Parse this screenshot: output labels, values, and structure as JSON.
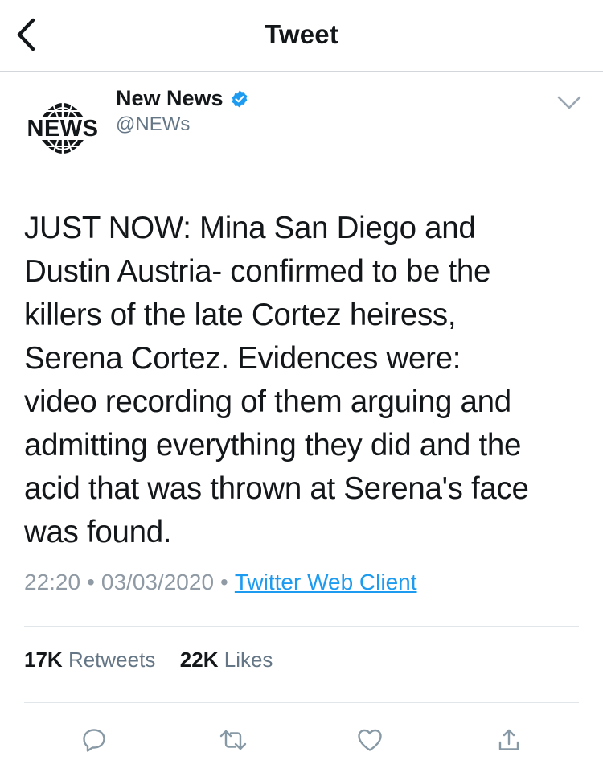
{
  "header": {
    "title": "Tweet",
    "back_icon": "chevron-left-icon"
  },
  "author": {
    "avatar_text": "NEWS",
    "name": "New News",
    "handle": "@NEWs",
    "verified": true,
    "verified_color": "#1d9bf0"
  },
  "tweet": {
    "text": "JUST NOW: Mina San Diego and\nDustin Austria- confirmed to be the\nkillers of the late Cortez heiress,\nSerena Cortez. Evidences were:\nvideo recording of them arguing and\nadmitting everything they did and the\nacid that was thrown at Serena's face\nwas found.",
    "time": "22:20",
    "separator": "•",
    "date": "03/03/2020",
    "source": "Twitter Web Client"
  },
  "stats": {
    "retweets_count": "17K",
    "retweets_label": "Retweets",
    "likes_count": "22K",
    "likes_label": "Likes"
  },
  "actions": [
    "reply-icon",
    "retweet-icon",
    "like-icon",
    "share-icon"
  ],
  "colors": {
    "link": "#1d9bf0",
    "muted": "#657786",
    "icon": "#8899a6",
    "divider": "#e1e6ea"
  }
}
